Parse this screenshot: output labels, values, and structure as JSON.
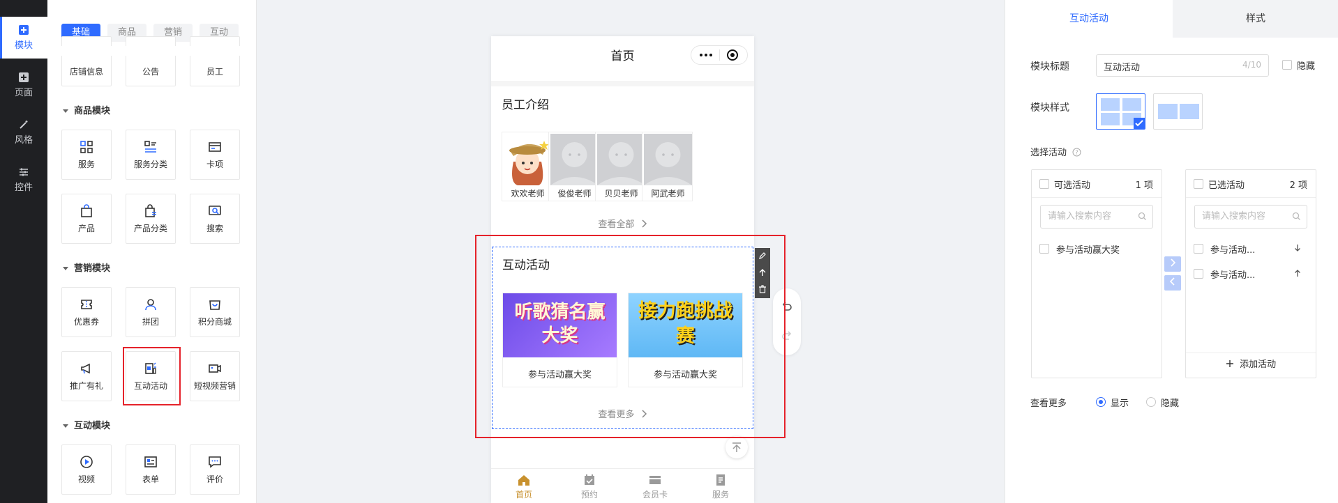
{
  "rail": [
    {
      "label": "模块",
      "icon": "plus-square-icon"
    },
    {
      "label": "页面",
      "icon": "plus-square-icon"
    },
    {
      "label": "风格",
      "icon": "magic-wand-icon"
    },
    {
      "label": "控件",
      "icon": "sliders-icon"
    }
  ],
  "panel": {
    "tabs": [
      "基础",
      "商品",
      "营销",
      "互动"
    ],
    "top_tiles": [
      "店铺信息",
      "公告",
      "员工"
    ],
    "sections": [
      {
        "title": "商品模块",
        "tiles": [
          {
            "label": "服务",
            "icon": "grid-icon"
          },
          {
            "label": "服务分类",
            "icon": "list-icon"
          },
          {
            "label": "卡项",
            "icon": "card-icon"
          },
          {
            "label": "产品",
            "icon": "bag-icon"
          },
          {
            "label": "产品分类",
            "icon": "bag-list-icon"
          },
          {
            "label": "搜索",
            "icon": "search-icon"
          }
        ]
      },
      {
        "title": "营销模块",
        "tiles": [
          {
            "label": "优惠券",
            "icon": "coupon-icon"
          },
          {
            "label": "拼团",
            "icon": "group-icon"
          },
          {
            "label": "积分商城",
            "icon": "shop-icon"
          },
          {
            "label": "推广有礼",
            "icon": "megaphone-icon"
          },
          {
            "label": "互动活动",
            "icon": "interactive-icon"
          },
          {
            "label": "短视频营销",
            "icon": "video-camera-icon"
          }
        ]
      },
      {
        "title": "互动模块",
        "tiles": [
          {
            "label": "视频",
            "icon": "play-icon"
          },
          {
            "label": "表单",
            "icon": "form-icon"
          },
          {
            "label": "评价",
            "icon": "comment-icon"
          }
        ]
      }
    ]
  },
  "phone": {
    "title": "首页",
    "staff_section": "员工介绍",
    "staff": [
      "欢欢老师",
      "俊俊老师",
      "贝贝老师",
      "阿武老师"
    ],
    "staff_more": "查看全部",
    "activity_section": "互动活动",
    "activities": [
      {
        "caption": "参与活动赢大奖",
        "banner": "听歌猜名赢大奖",
        "color": "#7c5cf5"
      },
      {
        "caption": "参与活动赢大奖",
        "banner": "接力跑挑战赛",
        "color": "#f3b400"
      }
    ],
    "activity_more": "查看更多",
    "bottom_nav": [
      "首页",
      "预约",
      "会员卡",
      "服务"
    ]
  },
  "settings": {
    "tabs": [
      "互动活动",
      "样式"
    ],
    "module_title_label": "模块标题",
    "module_title_value": "互动活动",
    "module_title_count": "4/10",
    "hide_label": "隐藏",
    "module_style_label": "模块样式",
    "select_activity_label": "选择活动",
    "available": {
      "title": "可选活动",
      "count": "1 项",
      "placeholder": "请输入搜索内容",
      "items": [
        "参与活动赢大奖"
      ]
    },
    "selected": {
      "title": "已选活动",
      "count": "2 项",
      "placeholder": "请输入搜索内容",
      "items": [
        "参与活动...",
        "参与活动..."
      ],
      "add": "添加活动"
    },
    "view_more_label": "查看更多",
    "show_label": "显示",
    "hide_option_label": "隐藏",
    "accent": "#2f6bff"
  }
}
